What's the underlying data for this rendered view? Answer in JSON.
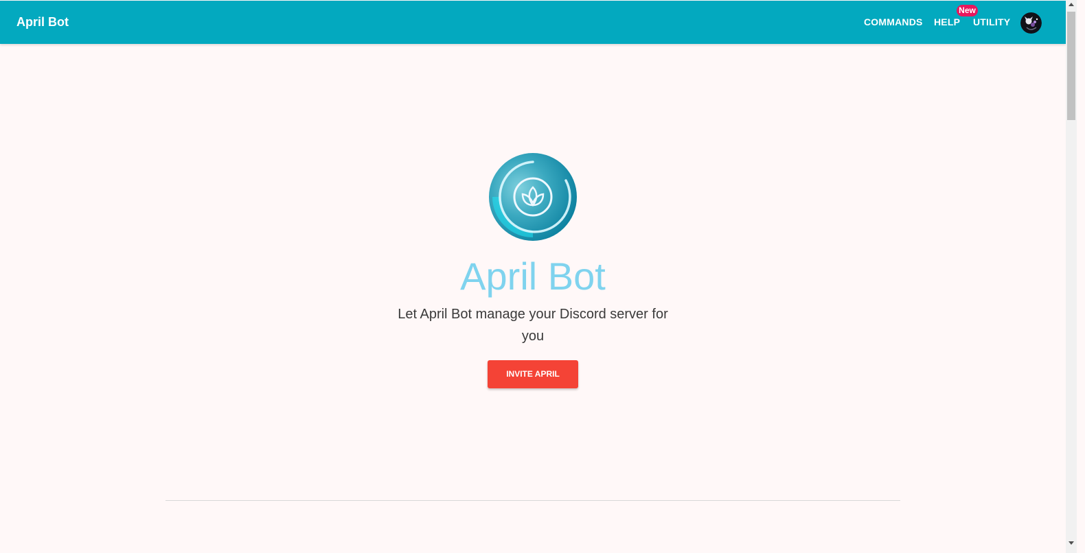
{
  "navbar": {
    "brand": "April Bot",
    "links": [
      {
        "label": "COMMANDS"
      },
      {
        "label": "HELP"
      },
      {
        "label": "UTILITY"
      }
    ],
    "badge": "New",
    "avatar_icon": "user-avatar"
  },
  "hero": {
    "logo_icon": "lotus-logo-icon",
    "title": "April Bot",
    "tagline": "Let April Bot manage your Discord server for you",
    "invite_button": "INVITE APRIL"
  },
  "colors": {
    "navbar": "#03a9bf",
    "badge": "#e8175d",
    "title": "#7fd3ee",
    "button": "#f44336",
    "background": "#fff8f8"
  }
}
